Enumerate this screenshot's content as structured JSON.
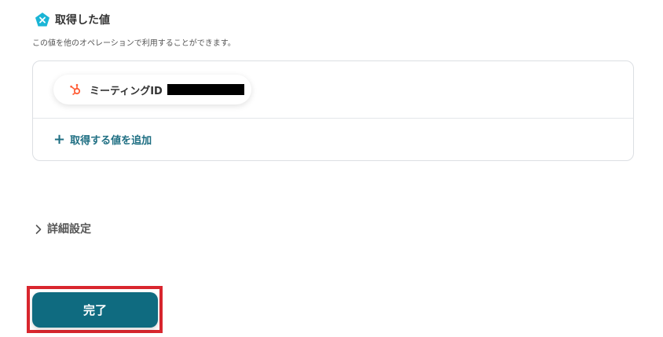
{
  "section": {
    "icon": "pentagon-x-icon",
    "title": "取得した値",
    "description": "この値を他のオペレーションで利用することができます。"
  },
  "values": {
    "chip": {
      "icon": "hubspot-icon",
      "label": "ミーティングID"
    },
    "add_label": "取得する値を追加"
  },
  "details": {
    "label": "詳細設定"
  },
  "actions": {
    "done_label": "完了"
  },
  "colors": {
    "accent": "#0f6b80",
    "link": "#1f6f83",
    "icon_teal": "#1ab5d6",
    "hubspot_orange": "#ff5c35",
    "highlight_red": "#d9262e"
  }
}
